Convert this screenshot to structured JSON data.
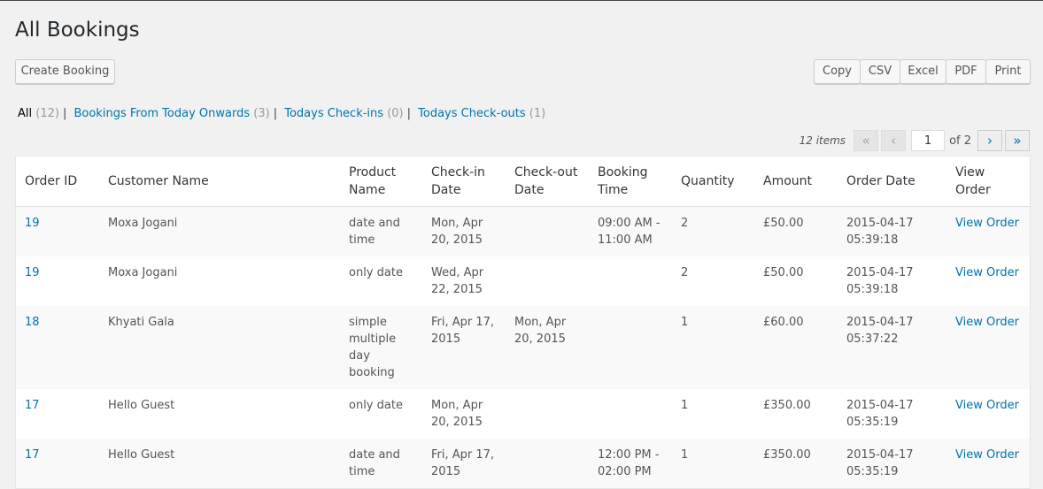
{
  "page": {
    "title": "All Bookings"
  },
  "toolbar": {
    "create_label": "Create Booking",
    "export_buttons": [
      "Copy",
      "CSV",
      "Excel",
      "PDF",
      "Print"
    ]
  },
  "filters": [
    {
      "label": "All",
      "count": "(12)",
      "current": true
    },
    {
      "label": "Bookings From Today Onwards",
      "count": "(3)",
      "current": false
    },
    {
      "label": "Todays Check-ins",
      "count": "(0)",
      "current": false
    },
    {
      "label": "Todays Check-outs",
      "count": "(1)",
      "current": false
    }
  ],
  "pagination": {
    "items_text": "12 items",
    "first": "«",
    "prev": "‹",
    "current_page": "1",
    "of_text": "of 2",
    "next": "›",
    "last": "»"
  },
  "table": {
    "headers": [
      "Order ID",
      "Customer Name",
      "Product Name",
      "Check-in Date",
      "Check-out Date",
      "Booking Time",
      "Quantity",
      "Amount",
      "Order Date",
      "View Order"
    ],
    "rows": [
      {
        "order_id": "19",
        "customer": "Moxa Jogani",
        "product": "date and time",
        "checkin": "Mon, Apr 20, 2015",
        "checkout": "",
        "time": "09:00 AM - 11:00 AM",
        "qty": "2",
        "amount": "£50.00",
        "order_date": "2015-04-17 05:39:18",
        "view": "View Order"
      },
      {
        "order_id": "19",
        "customer": "Moxa Jogani",
        "product": "only date",
        "checkin": "Wed, Apr 22, 2015",
        "checkout": "",
        "time": "",
        "qty": "2",
        "amount": "£50.00",
        "order_date": "2015-04-17 05:39:18",
        "view": "View Order"
      },
      {
        "order_id": "18",
        "customer": "Khyati Gala",
        "product": "simple multiple day booking",
        "checkin": "Fri, Apr 17, 2015",
        "checkout": "Mon, Apr 20, 2015",
        "time": "",
        "qty": "1",
        "amount": "£60.00",
        "order_date": "2015-04-17 05:37:22",
        "view": "View Order"
      },
      {
        "order_id": "17",
        "customer": "Hello Guest",
        "product": "only date",
        "checkin": "Mon, Apr 20, 2015",
        "checkout": "",
        "time": "",
        "qty": "1",
        "amount": "£350.00",
        "order_date": "2015-04-17 05:35:19",
        "view": "View Order"
      },
      {
        "order_id": "17",
        "customer": "Hello Guest",
        "product": "date and time",
        "checkin": "Fri, Apr 17, 2015",
        "checkout": "",
        "time": "12:00 PM - 02:00 PM",
        "qty": "1",
        "amount": "£350.00",
        "order_date": "2015-04-17 05:35:19",
        "view": "View Order"
      }
    ]
  }
}
